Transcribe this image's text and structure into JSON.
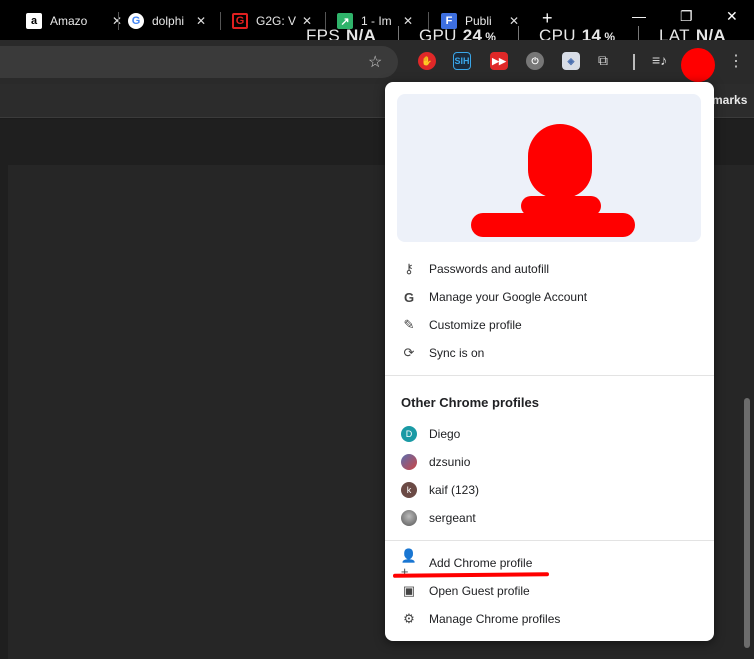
{
  "tabs": [
    {
      "title": "Amazo",
      "icon": "amazon-icon"
    },
    {
      "title": "dolphi",
      "icon": "google-icon"
    },
    {
      "title": "G2G: V",
      "icon": "g2g-icon"
    },
    {
      "title": "1 - Im",
      "icon": "image-icon"
    },
    {
      "title": "Publi",
      "icon": "f-icon"
    }
  ],
  "overlay": {
    "fps_label": "FPS",
    "fps_value": "N/A",
    "gpu_label": "GPU",
    "gpu_value": "24",
    "gpu_unit": "%",
    "cpu_label": "CPU",
    "cpu_value": "14",
    "cpu_unit": "%",
    "lat_label": "LAT",
    "lat_value": "N/A"
  },
  "bookmarks": {
    "partial_text": "marks"
  },
  "profile_menu": {
    "actions": [
      {
        "label": "Passwords and autofill",
        "icon": "key-icon"
      },
      {
        "label": "Manage your Google Account",
        "icon": "google-g-icon"
      },
      {
        "label": "Customize profile",
        "icon": "pencil-icon"
      },
      {
        "label": "Sync is on",
        "icon": "sync-icon"
      }
    ],
    "other_profiles_title": "Other Chrome profiles",
    "profiles": [
      {
        "label": "Diego",
        "initial": "D",
        "color": "#1a9aa5"
      },
      {
        "label": "dzsunio",
        "initial": "",
        "color": "#5a6fb0"
      },
      {
        "label": "kaif (123)",
        "initial": "k",
        "color": "#6b4a45"
      },
      {
        "label": "sergeant",
        "initial": "",
        "color": "#8a8a8a"
      }
    ],
    "footer": [
      {
        "label": "Add Chrome profile",
        "icon": "add-person-icon"
      },
      {
        "label": "Open Guest profile",
        "icon": "guest-icon"
      },
      {
        "label": "Manage Chrome profiles",
        "icon": "manage-people-icon"
      }
    ]
  },
  "colors": {
    "accent_red": "#ff0000",
    "hero_bg": "#edf1f9"
  }
}
